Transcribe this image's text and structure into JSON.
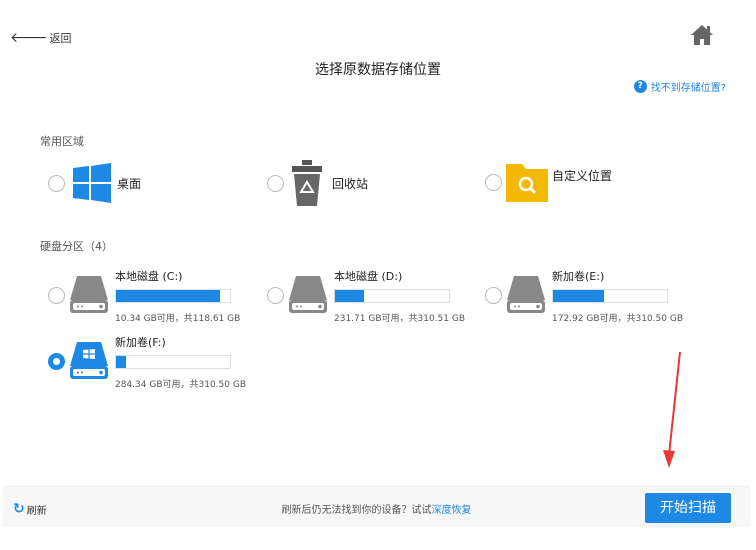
{
  "header": {
    "back_label": "返回",
    "title": "选择原数据存储位置",
    "help_label": "找不到存储位置?"
  },
  "common": {
    "title": "常用区域",
    "items": [
      {
        "label": "桌面",
        "icon": "windows-icon"
      },
      {
        "label": "回收站",
        "icon": "recycle-bin-icon"
      },
      {
        "label": "自定义位置",
        "icon": "folder-search-icon"
      }
    ]
  },
  "disks": {
    "title": "硬盘分区（4）",
    "items": [
      {
        "name": "本地磁盘 (C:)",
        "caption": "10.34 GB可用，共118.61 GB",
        "used_fraction": 0.913,
        "selected": false
      },
      {
        "name": "本地磁盘 (D:)",
        "caption": "231.71 GB可用，共310.51 GB",
        "used_fraction": 0.254,
        "selected": false
      },
      {
        "name": "新加卷(E:)",
        "caption": "172.92 GB可用，共310.50 GB",
        "used_fraction": 0.443,
        "selected": false
      },
      {
        "name": "新加卷(F:)",
        "caption": "284.34 GB可用，共310.50 GB",
        "used_fraction": 0.084,
        "selected": true
      }
    ]
  },
  "footer": {
    "refresh_label": "刷新",
    "hint": "刷新后仍无法找到你的设备？试试",
    "hint_link": "深度恢复",
    "scan_label": "开始扫描"
  },
  "colors": {
    "accent": "#1e88e5",
    "folder": "#f5b800",
    "annotation": "#e53935"
  }
}
